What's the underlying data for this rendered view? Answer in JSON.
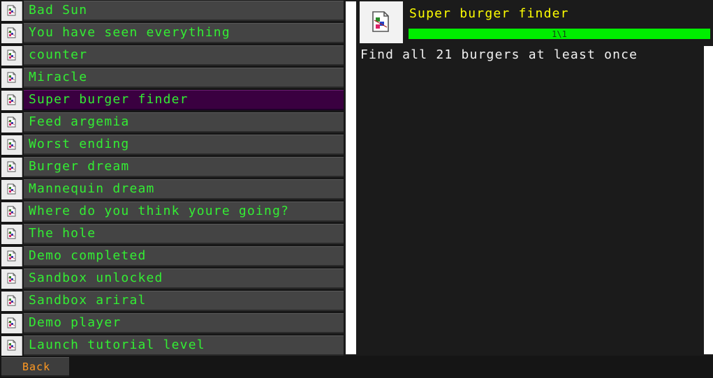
{
  "achievements": [
    {
      "label": "Bad Sun",
      "icon": "broken-image-icon",
      "selected": false
    },
    {
      "label": "You have seen everything",
      "icon": "broken-image-icon",
      "selected": false
    },
    {
      "label": "counter",
      "icon": "broken-image-icon",
      "selected": false
    },
    {
      "label": "Miracle",
      "icon": "broken-image-icon",
      "selected": false
    },
    {
      "label": "Super burger finder",
      "icon": "broken-image-icon",
      "selected": true
    },
    {
      "label": "Feed argemia",
      "icon": "broken-image-icon",
      "selected": false
    },
    {
      "label": "Worst ending",
      "icon": "broken-image-icon",
      "selected": false
    },
    {
      "label": "Burger dream",
      "icon": "broken-image-icon",
      "selected": false
    },
    {
      "label": "Mannequin dream",
      "icon": "broken-image-icon",
      "selected": false
    },
    {
      "label": "Where do you think youre going?",
      "icon": "broken-image-icon",
      "selected": false
    },
    {
      "label": "The hole",
      "icon": "broken-image-icon",
      "selected": false
    },
    {
      "label": "Demo completed",
      "icon": "broken-image-icon",
      "selected": false
    },
    {
      "label": "Sandbox unlocked",
      "icon": "broken-image-icon",
      "selected": false
    },
    {
      "label": "Sandbox ariral",
      "icon": "broken-image-icon",
      "selected": false
    },
    {
      "label": "Demo player",
      "icon": "broken-image-icon",
      "selected": false
    },
    {
      "label": "Launch tutorial level",
      "icon": "broken-image-icon",
      "selected": false
    }
  ],
  "detail": {
    "title": "Super burger finder",
    "icon": "broken-image-icon",
    "progress_text": "1\\1",
    "progress_fraction": 1.0,
    "description": "Find all 21 burgers at least once"
  },
  "footer": {
    "back_label": "Back"
  },
  "colors": {
    "label_green": "#33ee33",
    "selected_row": "#3a0040",
    "title_yellow": "#ffff00",
    "progress_green": "#00ee00",
    "back_orange": "#ff9922"
  }
}
